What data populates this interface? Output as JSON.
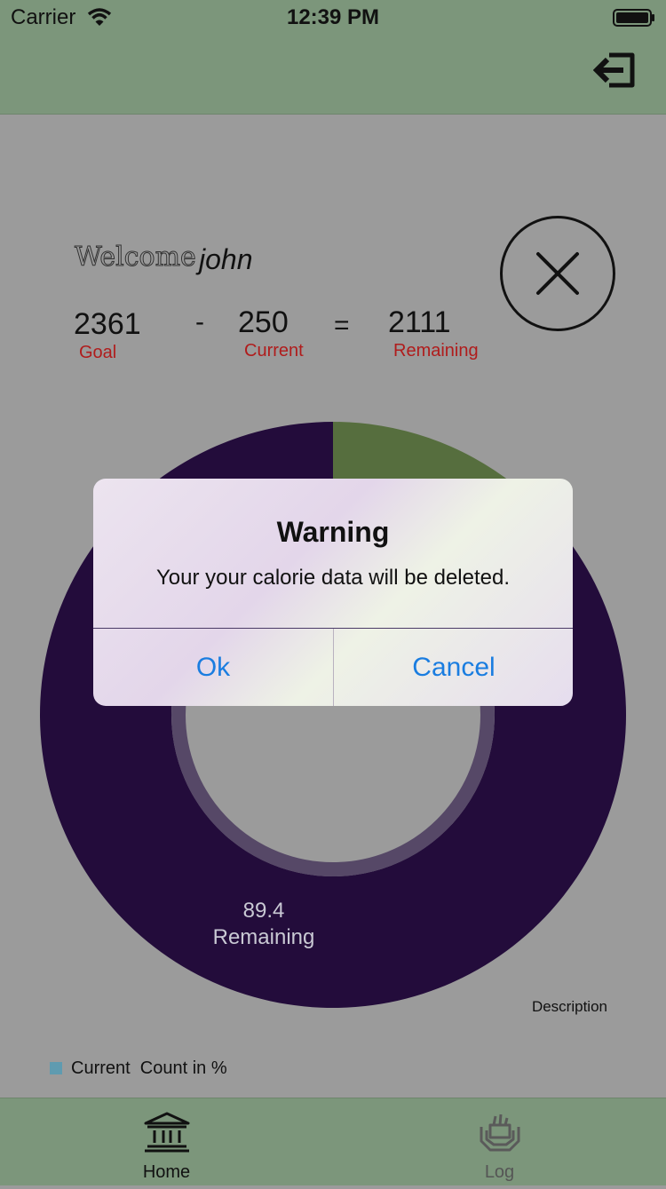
{
  "status_bar": {
    "carrier": "Carrier",
    "time": "12:39 PM"
  },
  "header": {
    "logout_icon": "logout-icon"
  },
  "summary": {
    "welcome": "Welcome",
    "username": "john",
    "goal_value": "2361",
    "goal_label": "Goal",
    "minus": "-",
    "current_value": "250",
    "current_label": "Current",
    "equals": "=",
    "remaining_value": "2111",
    "remaining_label": "Remaining",
    "close_icon": "close-circle-icon"
  },
  "chart_data": {
    "type": "pie",
    "slices": [
      {
        "label": "Current",
        "value": 10.6,
        "color": "#566e3e"
      },
      {
        "label": "Remaining",
        "value": 89.4,
        "color": "#230c3b"
      }
    ],
    "visible_slice_label_value": "89.4",
    "visible_slice_label_name": "Remaining",
    "description": "Description",
    "legend": {
      "entries": [
        "Current  Count in %"
      ],
      "swatch_color": "#5f9bb0",
      "placement": "bottom-left"
    }
  },
  "tabbar": {
    "tabs": [
      {
        "label": "Home",
        "icon": "bank-icon",
        "selected": true
      },
      {
        "label": "Log",
        "icon": "food-basket-icon",
        "selected": false
      }
    ]
  },
  "alert": {
    "title": "Warning",
    "message": "Your your calorie data will be deleted.",
    "ok_label": "Ok",
    "cancel_label": "Cancel",
    "button_color": "#1a7de0"
  }
}
